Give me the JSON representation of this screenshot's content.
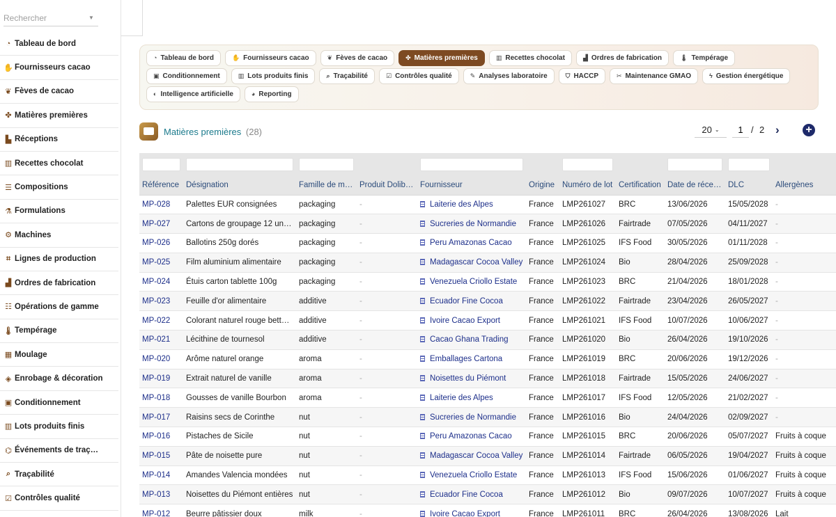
{
  "sidebar": {
    "search": {
      "placeholder": "Rechercher"
    },
    "items": [
      {
        "label": "Tableau de bord",
        "icon": "gauge-icon",
        "glyph": "◔"
      },
      {
        "label": "Fournisseurs cacao",
        "icon": "handshake-icon",
        "glyph": "✋"
      },
      {
        "label": "Fèves de cacao",
        "icon": "seedling-icon",
        "glyph": "❦"
      },
      {
        "label": "Matières premières",
        "icon": "ingredients-icon",
        "glyph": "✤"
      },
      {
        "label": "Réceptions",
        "icon": "truck-icon",
        "glyph": "▙"
      },
      {
        "label": "Recettes chocolat",
        "icon": "book-icon",
        "glyph": "▥"
      },
      {
        "label": "Compositions",
        "icon": "list-icon",
        "glyph": "☰"
      },
      {
        "label": "Formulations",
        "icon": "flask-icon",
        "glyph": "⚗"
      },
      {
        "label": "Machines",
        "icon": "gears-icon",
        "glyph": "⚙"
      },
      {
        "label": "Lignes de production",
        "icon": "diagram-icon",
        "glyph": "⌗"
      },
      {
        "label": "Ordres de fabrication",
        "icon": "industry-icon",
        "glyph": "▟"
      },
      {
        "label": "Opérations de gamme",
        "icon": "list-check-icon",
        "glyph": "☷"
      },
      {
        "label": "Tempérage",
        "icon": "thermometer-icon",
        "glyph": "🌡"
      },
      {
        "label": "Moulage",
        "icon": "grid-icon",
        "glyph": "▦"
      },
      {
        "label": "Enrobage & décoration",
        "icon": "fill-drip-icon",
        "glyph": "◈"
      },
      {
        "label": "Conditionnement",
        "icon": "box-icon",
        "glyph": "▣"
      },
      {
        "label": "Lots produits finis",
        "icon": "barcode-icon",
        "glyph": "▥"
      },
      {
        "label": "Événements de traç…",
        "icon": "sitemap-icon",
        "glyph": "⌬"
      },
      {
        "label": "Traçabilité",
        "icon": "magnifier-icon",
        "glyph": "⌕"
      },
      {
        "label": "Contrôles qualité",
        "icon": "clipboard-check-icon",
        "glyph": "☑"
      }
    ]
  },
  "modules": [
    {
      "label": "Tableau de bord",
      "icon": "gauge-icon",
      "glyph": "◔",
      "active": false
    },
    {
      "label": "Fournisseurs cacao",
      "icon": "handshake-icon",
      "glyph": "✋",
      "active": false
    },
    {
      "label": "Fèves de cacao",
      "icon": "seedling-icon",
      "glyph": "❦",
      "active": false
    },
    {
      "label": "Matières premières",
      "icon": "ingredients-icon",
      "glyph": "✤",
      "active": true
    },
    {
      "label": "Recettes chocolat",
      "icon": "book-icon",
      "glyph": "▥",
      "active": false
    },
    {
      "label": "Ordres de fabrication",
      "icon": "industry-icon",
      "glyph": "▟",
      "active": false
    },
    {
      "label": "Tempérage",
      "icon": "thermometer-icon",
      "glyph": "🌡",
      "active": false
    },
    {
      "label": "Conditionnement",
      "icon": "box-icon",
      "glyph": "▣",
      "active": false
    },
    {
      "label": "Lots produits finis",
      "icon": "barcode-icon",
      "glyph": "▥",
      "active": false
    },
    {
      "label": "Traçabilité",
      "icon": "magnifier-icon",
      "glyph": "⌕",
      "active": false
    },
    {
      "label": "Contrôles qualité",
      "icon": "clipboard-check-icon",
      "glyph": "☑",
      "active": false
    },
    {
      "label": "Analyses laboratoire",
      "icon": "pen-icon",
      "glyph": "✎",
      "active": false
    },
    {
      "label": "HACCP",
      "icon": "shield-icon",
      "glyph": "⛉",
      "active": false
    },
    {
      "label": "Maintenance GMAO",
      "icon": "tools-icon",
      "glyph": "✂",
      "active": false
    },
    {
      "label": "Gestion énergétique",
      "icon": "bolt-icon",
      "glyph": "ϟ",
      "active": false
    },
    {
      "label": "Intelligence artificielle",
      "icon": "brain-icon",
      "glyph": "◐",
      "active": false
    },
    {
      "label": "Reporting",
      "icon": "chart-pie-icon",
      "glyph": "◕",
      "active": false
    }
  ],
  "list": {
    "title": "Matières premières",
    "count": "(28)",
    "page_size": "20",
    "page_current": "1",
    "page_separator": "/",
    "page_total": "2"
  },
  "table": {
    "columns": [
      "Référence",
      "Désignation",
      "Famille de m…",
      "Produit Dolib…",
      "Fournisseur",
      "Origine",
      "Numéro de lot",
      "Certification",
      "Date de récep…",
      "DLC",
      "Allergènes"
    ],
    "rows": [
      [
        "MP-028",
        "Palettes EUR consignées",
        "packaging",
        "-",
        "Laiterie des Alpes",
        "France",
        "LMP261027",
        "BRC",
        "13/06/2026",
        "15/05/2028",
        "-"
      ],
      [
        "MP-027",
        "Cartons de groupage 12 uni…",
        "packaging",
        "-",
        "Sucreries de Normandie",
        "France",
        "LMP261026",
        "Fairtrade",
        "07/05/2026",
        "04/11/2027",
        "-"
      ],
      [
        "MP-026",
        "Ballotins 250g dorés",
        "packaging",
        "-",
        "Peru Amazonas Cacao",
        "France",
        "LMP261025",
        "IFS Food",
        "30/05/2026",
        "01/11/2028",
        "-"
      ],
      [
        "MP-025",
        "Film aluminium alimentaire",
        "packaging",
        "-",
        "Madagascar Cocoa Valley",
        "France",
        "LMP261024",
        "Bio",
        "28/04/2026",
        "25/09/2028",
        "-"
      ],
      [
        "MP-024",
        "Étuis carton tablette 100g",
        "packaging",
        "-",
        "Venezuela Criollo Estate",
        "France",
        "LMP261023",
        "BRC",
        "21/04/2026",
        "18/01/2028",
        "-"
      ],
      [
        "MP-023",
        "Feuille d'or alimentaire",
        "additive",
        "-",
        "Ecuador Fine Cocoa",
        "France",
        "LMP261022",
        "Fairtrade",
        "23/04/2026",
        "26/05/2027",
        "-"
      ],
      [
        "MP-022",
        "Colorant naturel rouge bette…",
        "additive",
        "-",
        "Ivoire Cacao Export",
        "France",
        "LMP261021",
        "IFS Food",
        "10/07/2026",
        "10/06/2027",
        "-"
      ],
      [
        "MP-021",
        "Lécithine de tournesol",
        "additive",
        "-",
        "Cacao Ghana Trading",
        "France",
        "LMP261020",
        "Bio",
        "26/04/2026",
        "19/10/2026",
        "-"
      ],
      [
        "MP-020",
        "Arôme naturel orange",
        "aroma",
        "-",
        "Emballages Cartona",
        "France",
        "LMP261019",
        "BRC",
        "20/06/2026",
        "19/12/2026",
        "-"
      ],
      [
        "MP-019",
        "Extrait naturel de vanille",
        "aroma",
        "-",
        "Noisettes du Piémont",
        "France",
        "LMP261018",
        "Fairtrade",
        "15/05/2026",
        "24/06/2027",
        "-"
      ],
      [
        "MP-018",
        "Gousses de vanille Bourbon",
        "aroma",
        "-",
        "Laiterie des Alpes",
        "France",
        "LMP261017",
        "IFS Food",
        "12/05/2026",
        "21/02/2027",
        "-"
      ],
      [
        "MP-017",
        "Raisins secs de Corinthe",
        "nut",
        "-",
        "Sucreries de Normandie",
        "France",
        "LMP261016",
        "Bio",
        "24/04/2026",
        "02/09/2027",
        "-"
      ],
      [
        "MP-016",
        "Pistaches de Sicile",
        "nut",
        "-",
        "Peru Amazonas Cacao",
        "France",
        "LMP261015",
        "BRC",
        "20/06/2026",
        "05/07/2027",
        "Fruits à coque"
      ],
      [
        "MP-015",
        "Pâte de noisette pure",
        "nut",
        "-",
        "Madagascar Cocoa Valley",
        "France",
        "LMP261014",
        "Fairtrade",
        "06/05/2026",
        "19/04/2027",
        "Fruits à coque"
      ],
      [
        "MP-014",
        "Amandes Valencia mondées",
        "nut",
        "-",
        "Venezuela Criollo Estate",
        "France",
        "LMP261013",
        "IFS Food",
        "15/06/2026",
        "01/06/2027",
        "Fruits à coque"
      ],
      [
        "MP-013",
        "Noisettes du Piémont entières",
        "nut",
        "-",
        "Ecuador Fine Cocoa",
        "France",
        "LMP261012",
        "Bio",
        "09/07/2026",
        "10/07/2027",
        "Fruits à coque"
      ],
      [
        "MP-012",
        "Beurre pâtissier doux",
        "milk",
        "-",
        "Ivoire Cacao Export",
        "France",
        "LMP261011",
        "BRC",
        "26/04/2026",
        "13/08/2026",
        "Lait"
      ]
    ]
  }
}
